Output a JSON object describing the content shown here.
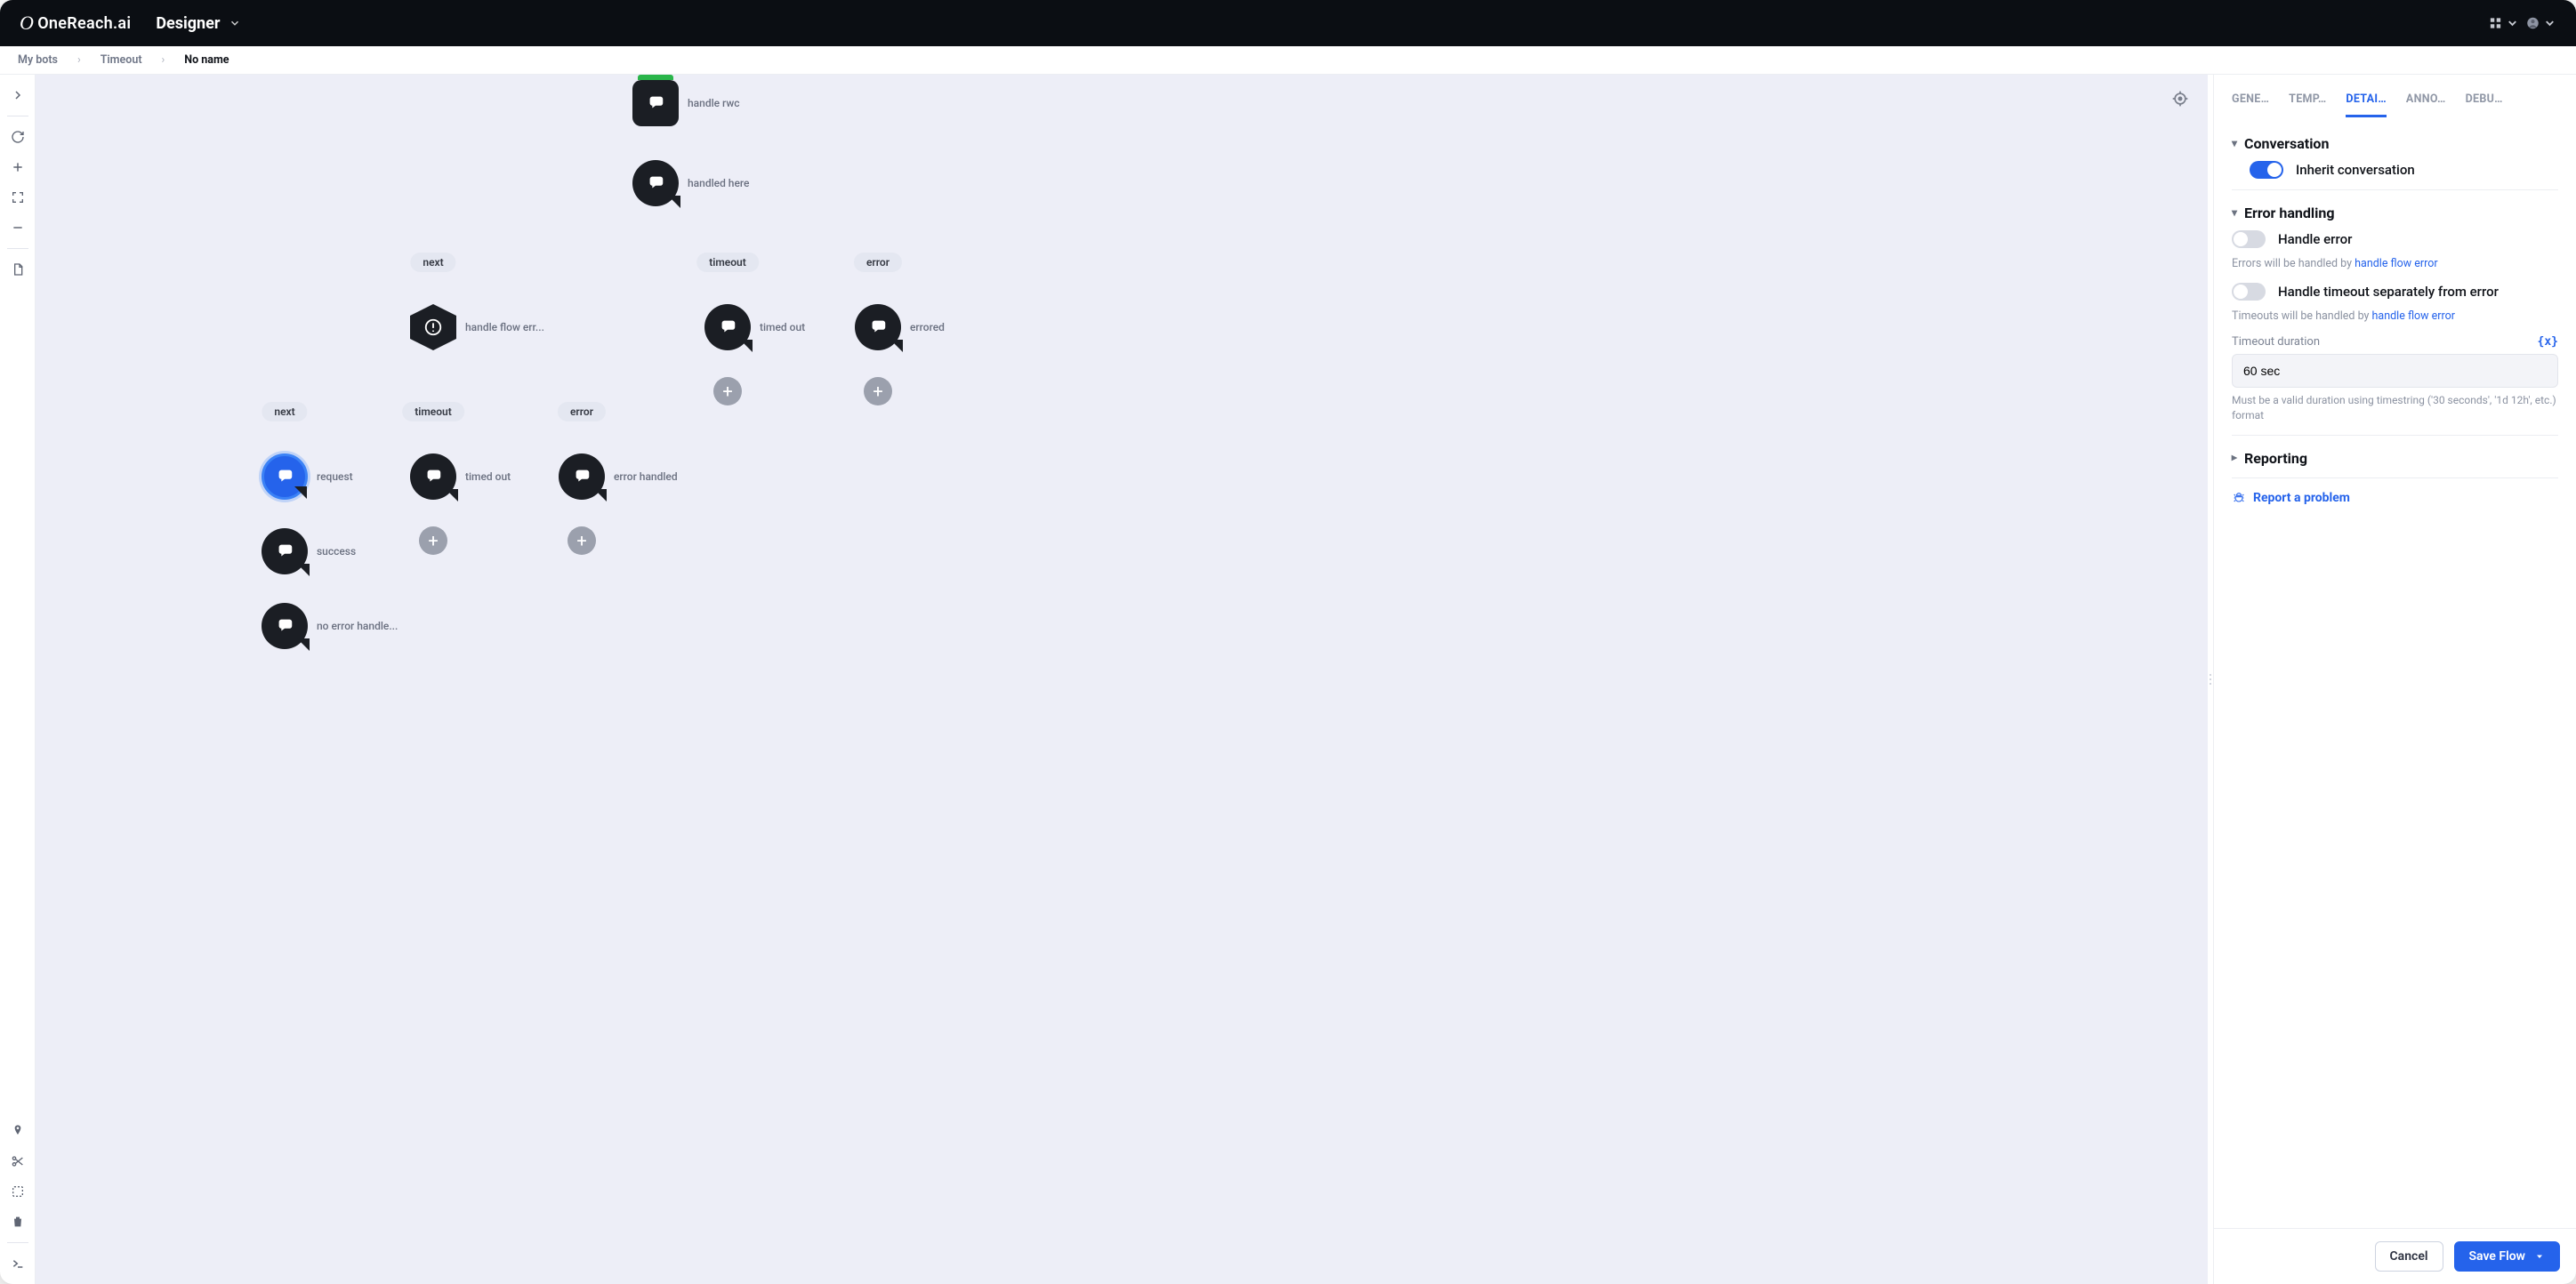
{
  "brand": "OneReach.ai",
  "app_name": "Designer",
  "breadcrumbs": {
    "root": "My bots",
    "mid": "Timeout",
    "current": "No name"
  },
  "panel": {
    "tabs": [
      "GENE…",
      "TEMP…",
      "DETAI…",
      "ANNO…",
      "DEBU…"
    ],
    "active_tab": 2,
    "conversation": {
      "title": "Conversation",
      "inherit_label": "Inherit conversation",
      "inherit_on": true
    },
    "error": {
      "title": "Error handling",
      "handle_error_label": "Handle error",
      "handle_error_on": false,
      "handle_error_help_prefix": "Errors will be handled by ",
      "handle_error_help_link": "handle flow error",
      "handle_timeout_label": "Handle timeout separately from error",
      "handle_timeout_on": false,
      "handle_timeout_help_prefix": "Timeouts will be handled by ",
      "handle_timeout_help_link": "handle flow error",
      "timeout_field_label": "Timeout duration",
      "timeout_value": "60 sec",
      "timeout_hint": "Must be a valid duration using timestring ('30 seconds', '1d 12h', etc.) format"
    },
    "reporting": {
      "title": "Reporting"
    },
    "report_problem": "Report a problem"
  },
  "footer": {
    "cancel": "Cancel",
    "save": "Save Flow"
  },
  "nodes": {
    "handle_rwc": "handle rwc",
    "handled_here": "handled here",
    "handle_flow_err": "handle flow err...",
    "timed_out": "timed out",
    "errored": "errored",
    "request": "request",
    "timed_out2": "timed out",
    "error_handled": "error handled",
    "success": "success",
    "no_error": "no error handle..."
  },
  "chips": {
    "next": "next",
    "timeout": "timeout",
    "error": "error",
    "next2": "next",
    "timeout2": "timeout",
    "error2": "error"
  }
}
